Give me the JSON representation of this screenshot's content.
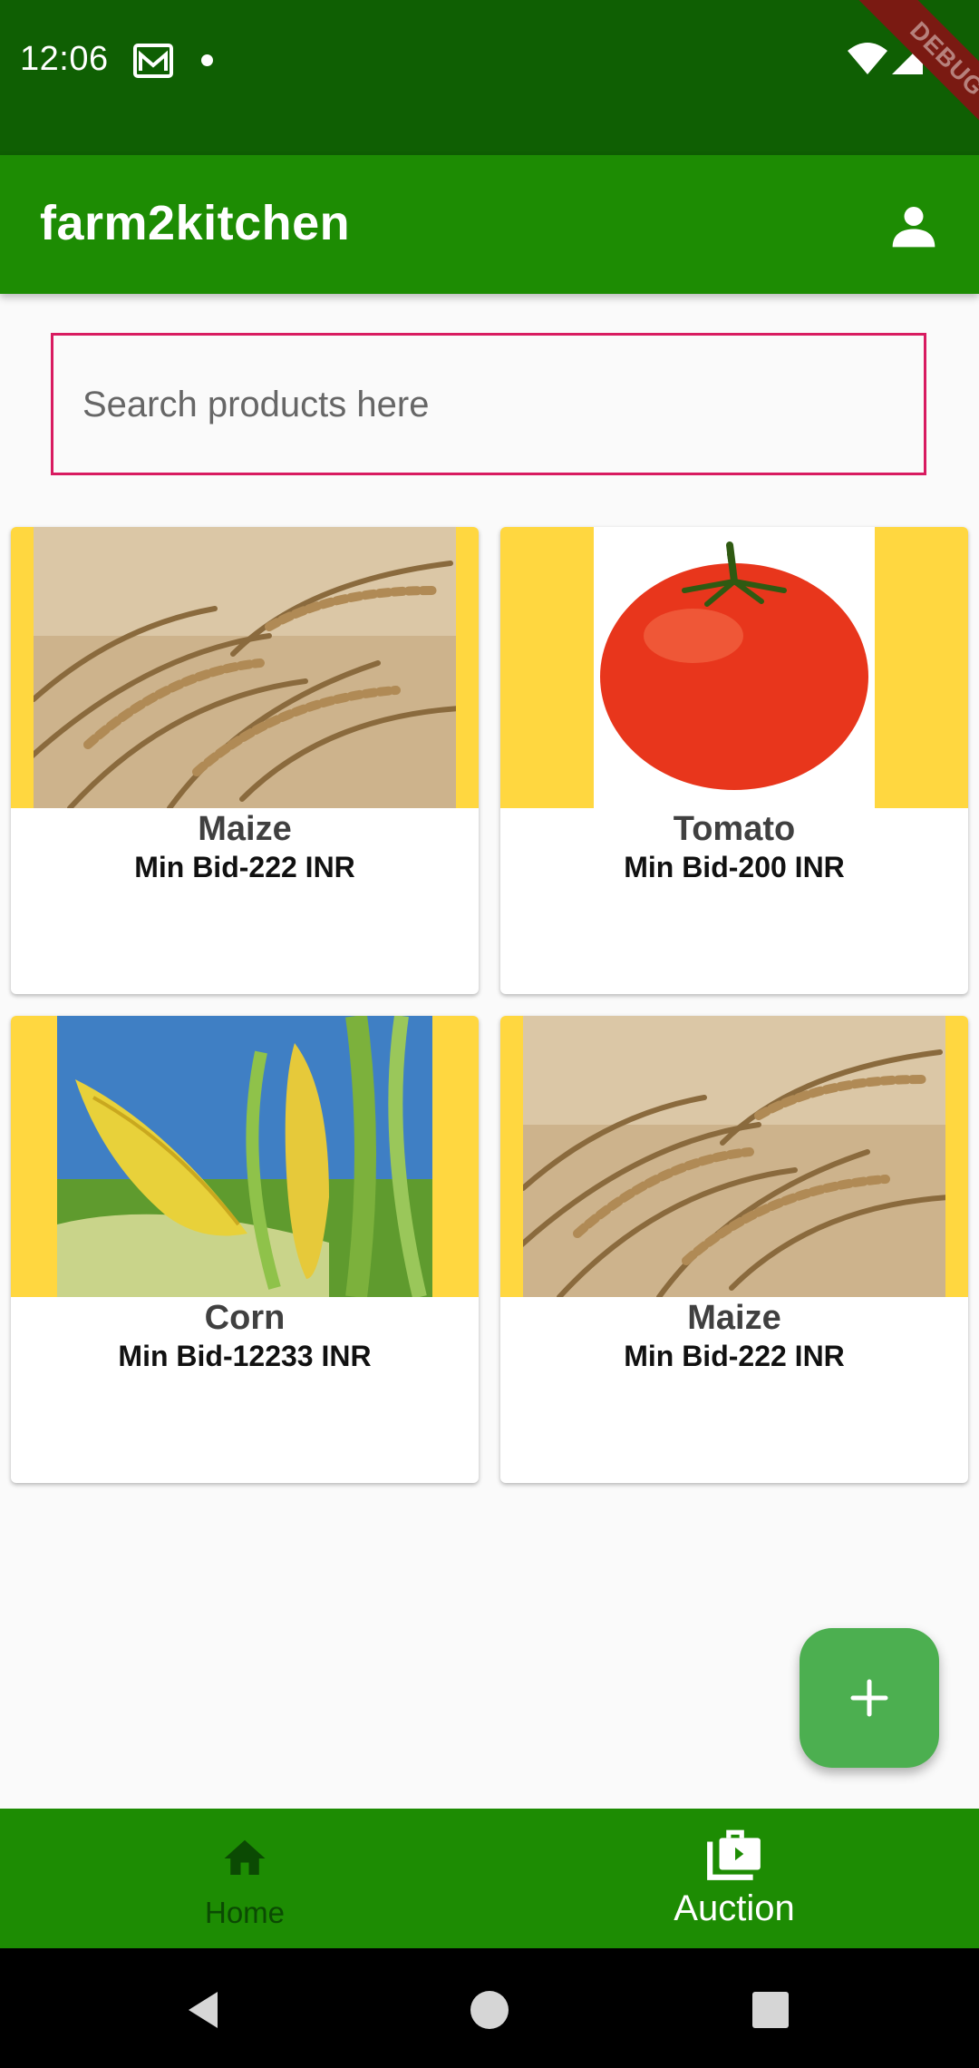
{
  "status_bar": {
    "time": "12:06",
    "debug_banner": "DEBUG",
    "icons": [
      "gmail-icon",
      "notification-dot-icon",
      "wifi-icon",
      "signal-icon",
      "battery-icon"
    ]
  },
  "app_bar": {
    "title": "farm2kitchen",
    "profile_icon": "person-icon",
    "background": "#1d8c03"
  },
  "search": {
    "placeholder": "Search products here",
    "value": ""
  },
  "products": [
    {
      "name": "Maize",
      "bid": "Min Bid-222 INR",
      "image": "wheat-field-image"
    },
    {
      "name": "Tomato",
      "bid": "Min Bid-200 INR",
      "image": "tomato-image"
    },
    {
      "name": "Corn",
      "bid": "Min Bid-12233 INR",
      "image": "corn-cob-image"
    },
    {
      "name": "Maize",
      "bid": "Min Bid-222 INR",
      "image": "wheat-field-image"
    }
  ],
  "fab": {
    "icon": "plus-icon",
    "color": "#4caf50"
  },
  "bottom_nav": {
    "items": [
      {
        "label": "Home",
        "icon": "home-icon",
        "selected": false
      },
      {
        "label": "Auction",
        "icon": "auction-briefcase-icon",
        "selected": true
      }
    ]
  },
  "system_nav": [
    "back-icon",
    "home-circle-icon",
    "recents-icon"
  ],
  "colors": {
    "status_bar": "#0f5f03",
    "accent_border": "#d81b60",
    "image_background": "#ffd740"
  }
}
